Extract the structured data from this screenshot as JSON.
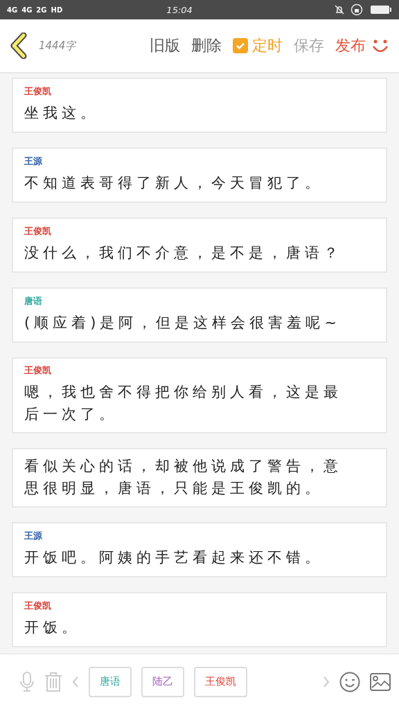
{
  "status_bar": {
    "network_labels": [
      "4G",
      "4G",
      "2G",
      "HD"
    ],
    "time": "15:04"
  },
  "toolbar": {
    "word_count": "1444字",
    "actions": [
      {
        "label": "旧版",
        "kind": "plain",
        "disabled": false
      },
      {
        "label": "删除",
        "kind": "plain",
        "disabled": false
      },
      {
        "label": "定时",
        "kind": "check",
        "checked": true,
        "disabled": false
      },
      {
        "label": "保存",
        "kind": "plain",
        "disabled": true
      },
      {
        "label": "发布",
        "kind": "publish",
        "disabled": false
      }
    ]
  },
  "messages": [
    {
      "speaker": {
        "name": "王俊凯",
        "color": "#d9443a"
      },
      "text": "坐我这。"
    },
    {
      "speaker": {
        "name": "王源",
        "color": "#2f5fa8"
      },
      "text": "不知道表哥得了新人，今天冒犯了。"
    },
    {
      "speaker": {
        "name": "王俊凯",
        "color": "#d9443a"
      },
      "text": "没什么，我们不介意，是不是，唐语？"
    },
    {
      "speaker": {
        "name": "唐语",
        "color": "#2aa79b"
      },
      "text": "(顺应着)是阿，但是这样会很害羞呢~"
    },
    {
      "speaker": {
        "name": "王俊凯",
        "color": "#d9443a"
      },
      "text": "嗯，我也舍不得把你给别人看，这是最后一次了。"
    },
    {
      "text": "看似关心的话，却被他说成了警告，意思很明显，唐语，只能是王俊凯的。"
    },
    {
      "speaker": {
        "name": "王源",
        "color": "#2f5fa8"
      },
      "text": "开饭吧。阿姨的手艺看起来还不错。"
    },
    {
      "speaker": {
        "name": "王俊凯",
        "color": "#d9443a"
      },
      "text": "开饭。"
    }
  ],
  "characters": [
    {
      "name": "唐语",
      "color": "#2aa79b"
    },
    {
      "name": "陆乙",
      "color": "#a05cc0"
    },
    {
      "name": "王俊凯",
      "color": "#d9443a"
    }
  ]
}
